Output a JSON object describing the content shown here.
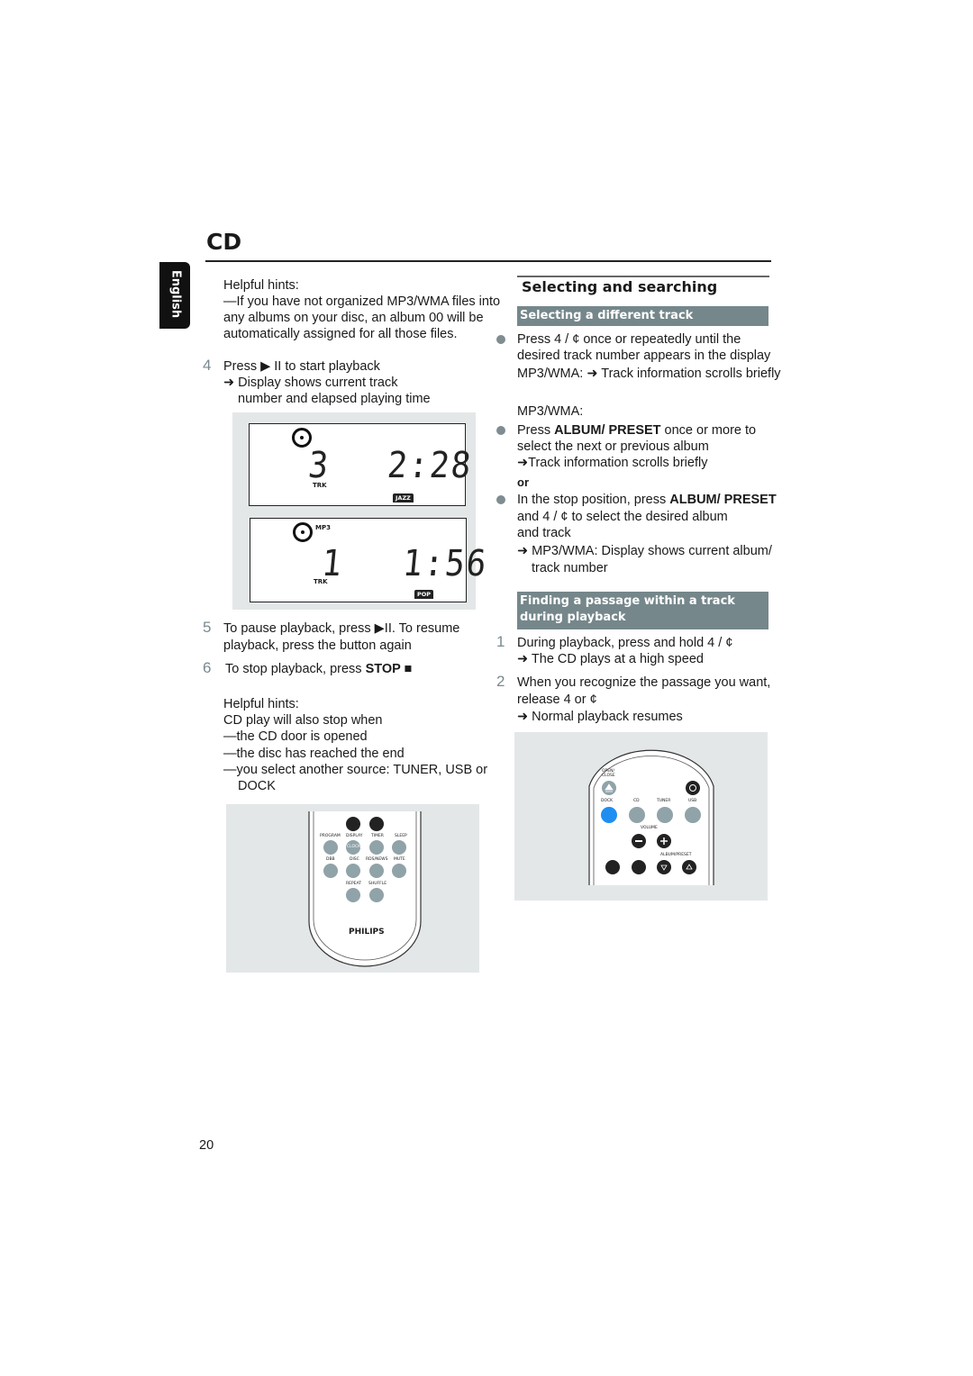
{
  "header": {
    "title": "CD",
    "language_tab": "English"
  },
  "left": {
    "hints1": [
      "Helpful hints:",
      "—If you have not organized MP3/WMA files into",
      "any albums on your disc, an album 00 will be",
      "automatically assigned for all those files."
    ],
    "step4": {
      "num": "4",
      "lines": [
        "Press ▶ II to start playback",
        "➜ Display shows current track",
        "number and elapsed playing time"
      ]
    },
    "display1": {
      "track": "3",
      "time": "2:28",
      "trk_label": "TRK",
      "genre": "JAZZ"
    },
    "display2": {
      "track": "1",
      "time": "1:56",
      "trk_label": "TRK",
      "format": "MP3",
      "genre": "POP"
    },
    "step5": {
      "num": "5",
      "lines": [
        "To pause playback, press ▶II. To resume",
        "playback, press the button again"
      ]
    },
    "step6": {
      "num": "6",
      "prefix": "To stop playback, press ",
      "bold": "STOP ■"
    },
    "hints2": [
      "Helpful hints:",
      "CD play will also stop when",
      "—the CD door is opened",
      "—the disc has reached the end",
      "—you select another source: TUNER, USB or",
      "DOCK"
    ],
    "remote": {
      "labels": [
        "PROGRAM",
        "DISPLAY",
        "TIMER",
        "SLEEP",
        "DBB",
        "DISC",
        "RDS/NEWS",
        "MUTE",
        "REPEAT",
        "SHUFFLE"
      ],
      "clock": "CLOCK",
      "brand": "PHILIPS"
    }
  },
  "right": {
    "section_title": "Selecting and searching",
    "sub1": "Selecting a different track",
    "b1": [
      "Press 4  / ¢   once or repeatedly until the",
      "desired track number appears in the display",
      "MP3/WMA:  ➜ Track information scrolls briefly"
    ],
    "mp3_label": "MP3/WMA:",
    "b2": {
      "prefix": "Press ",
      "bold": "ALBUM/ PRESET",
      "suffix": " once or more to",
      "lines": [
        "select the next or previous album",
        "➜Track information scrolls briefly"
      ]
    },
    "or": "or",
    "b3": {
      "prefix": "In the stop position, press ",
      "bold": "ALBUM/ PRESET",
      "lines": [
        "and 4   / ¢    to  select the desired album",
        "and track",
        "➜ MP3/WMA:  Display shows current album/",
        "track number"
      ]
    },
    "sub2": [
      "Finding a passage within a track",
      "during playback"
    ],
    "step1": {
      "num": "1",
      "lines": [
        "During playback, press and hold 4  / ¢",
        "➜ The CD plays at a high speed"
      ]
    },
    "step2": {
      "num": "2",
      "lines": [
        "When you recognize the passage you want,",
        "release 4  or ¢",
        "➜ Normal playback resumes"
      ]
    },
    "remote": {
      "open_close": "OPEN/ CLOSE",
      "sources": [
        "DOCK",
        "CD",
        "TUNER",
        "USB"
      ],
      "volume": "VOLUME",
      "album_preset": "ALBUM/PRESET",
      "dock_color": "#1f8ef1"
    }
  },
  "footer": {
    "page_number": "20"
  }
}
